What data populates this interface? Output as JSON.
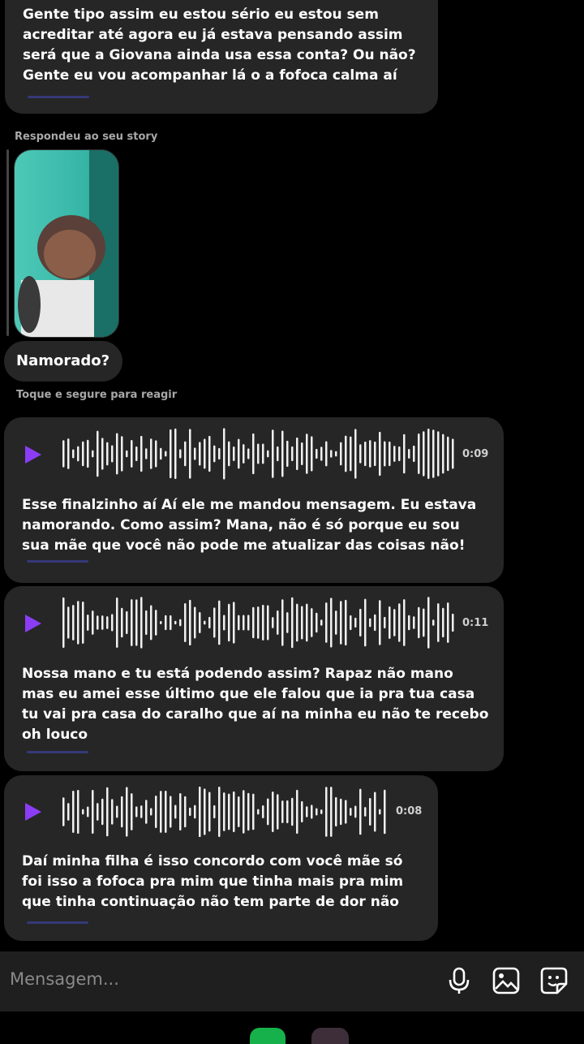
{
  "messages": {
    "top_text": "Gente tipo assim eu estou sério eu estou sem\nacreditar até agora eu já estava pensando assim\nserá que a Giovana ainda usa essa conta? Ou não?\nGente eu vou acompanhar lá o a fofoca calma aí",
    "story_reply_label": "Respondeu ao seu story",
    "story_reply_text": "Namorado?",
    "react_hint": "Toque e segure para reagir",
    "voice": [
      {
        "duration": "0:09",
        "transcript": "Esse finalzinho aí Aí ele me mandou mensagem. Eu estava\nnamorando. Como assim? Mana, não é só porque eu sou\nsua mãe que você não pode me atualizar das coisas não!"
      },
      {
        "duration": "0:11",
        "transcript": "Nossa mano e tu está podendo assim? Rapaz não mano\nmas eu amei esse último que ele falou que ia pra tua casa\ntu vai pra casa do caralho que aí na minha eu não te recebo\noh louco"
      },
      {
        "duration": "0:08",
        "transcript": "Daí minha filha é isso concordo com você mãe só\nfoi isso a fofoca pra mim que tinha mais pra mim\nque tinha continuação não tem parte de dor não"
      }
    ]
  },
  "composer": {
    "placeholder": "Mensagem...",
    "icons": [
      "microphone-icon",
      "gallery-icon",
      "sticker-icon"
    ]
  },
  "colors": {
    "background": "#000000",
    "bubble": "#262626",
    "play_accent": "#8b3df5"
  }
}
